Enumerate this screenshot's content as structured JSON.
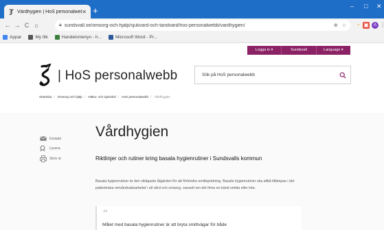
{
  "browser": {
    "tab_title": "Vårdhygien | HoS personalwebb",
    "tab_close": "✕",
    "new_tab": "+",
    "url": "sundsvall.se/omsorg-och-hjalp/sjukvard-och-tandvard/hos-personalwebb/vardhygien/",
    "window_controls": {
      "minimize": "–",
      "maximize": "□",
      "close": "✕"
    },
    "bookmarks": [
      {
        "label": "Appar",
        "color": "#4285f4"
      },
      {
        "label": "My Ilik",
        "color": "#555555"
      },
      {
        "label": "Handelsmenyn - h...",
        "color": "#3a7d3a"
      },
      {
        "label": "Microsoft Word - Pr...",
        "color": "#2b579a"
      }
    ],
    "profile_initial": "A"
  },
  "topnav": {
    "items": [
      "Logga in",
      "Sundsvall",
      "Language"
    ],
    "color": "#8c2266"
  },
  "header": {
    "site_name": "HoS personalwebb",
    "search_placeholder": "Sök på HoS personalwebb"
  },
  "breadcrumb": {
    "items": [
      "Startsida",
      "Omsorg och hjälp",
      "Hälso- och sjukvård",
      "HoS personalwebb"
    ],
    "current": "Vårdhygien",
    "separator": "/"
  },
  "side_tools": [
    {
      "label": "Kontakt",
      "icon": "mail-icon"
    },
    {
      "label": "Lyssna",
      "icon": "listen-icon"
    },
    {
      "label": "Skriv ut",
      "icon": "print-icon"
    }
  ],
  "article": {
    "title": "Vårdhygien",
    "lead": "Riktlinjer och rutiner kring basala hygienrutiner i Sundsvalls kommun",
    "body": "Basala hygienrutiner är den viktigaste åtgärden för att förhindra smittspridning. Basala hygienrutiner ska alltid tillämpas i det patientnära omvårdnadsarbetet i all vård och omsorg, oavsett om det finns en känd smitta eller inte.",
    "quote_mark": "“",
    "quote": "Målet med basala hygienrutiner är att bryta smittvägar för både"
  },
  "colors": {
    "accent": "#8c2266",
    "chrome": "#1e6ec8"
  }
}
